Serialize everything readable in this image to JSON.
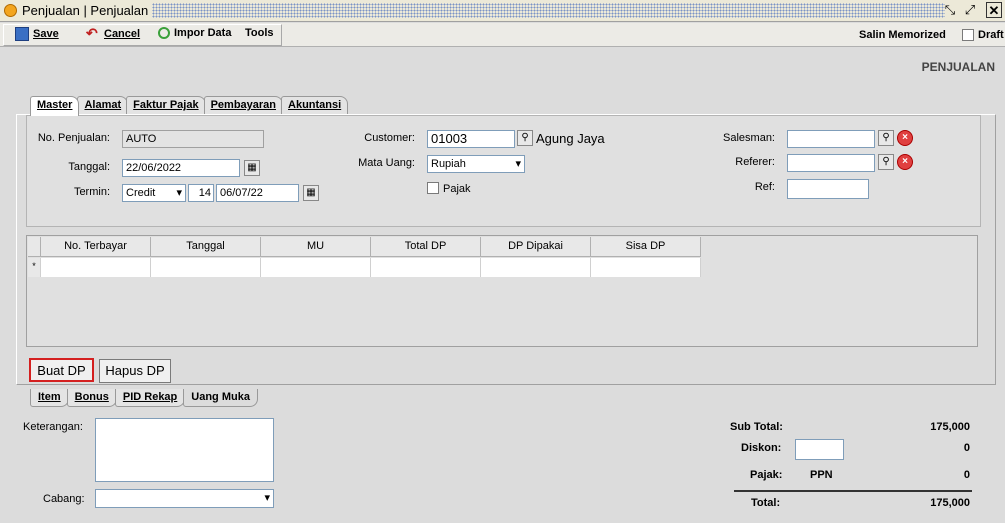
{
  "window": {
    "title": "Penjualan | Penjualan"
  },
  "toolbar": {
    "save": "Save",
    "cancel": "Cancel",
    "impor": "Impor Data",
    "tools": "Tools",
    "salin": "Salin Memorized",
    "draft": "Draft"
  },
  "page_heading": "PENJUALAN",
  "top_tabs": [
    "Master",
    "Alamat",
    "Faktur Pajak",
    "Pembayaran",
    "Akuntansi"
  ],
  "master": {
    "no_penjualan_label": "No. Penjualan:",
    "no_penjualan_value": "AUTO",
    "tanggal_label": "Tanggal:",
    "tanggal_value": "22/06/2022",
    "termin_label": "Termin:",
    "termin_value": "Credit",
    "termin_days": "14",
    "termin_date": "06/07/22",
    "customer_label": "Customer:",
    "customer_code": "01003",
    "customer_name": "Agung Jaya",
    "mata_uang_label": "Mata Uang:",
    "mata_uang_value": "Rupiah",
    "pajak_label": "Pajak",
    "salesman_label": "Salesman:",
    "referer_label": "Referer:",
    "ref_label": "Ref:"
  },
  "dp_table": {
    "columns": [
      "No. Terbayar",
      "Tanggal",
      "MU",
      "Total DP",
      "DP Dipakai",
      "Sisa DP"
    ],
    "row_marker": "*"
  },
  "buttons": {
    "buat_dp": "Buat DP",
    "hapus_dp": "Hapus DP"
  },
  "bottom_tabs": [
    "Item",
    "Bonus",
    "PID Rekap",
    "Uang Muka"
  ],
  "footer": {
    "keterangan_label": "Keterangan:",
    "cabang_label": "Cabang:",
    "sub_total_label": "Sub Total:",
    "sub_total_value": "175,000",
    "diskon_label": "Diskon:",
    "diskon_value": "0",
    "pajak_label": "Pajak:",
    "pajak_type": "PPN",
    "pajak_value": "0",
    "total_label": "Total:",
    "total_value": "175,000"
  }
}
